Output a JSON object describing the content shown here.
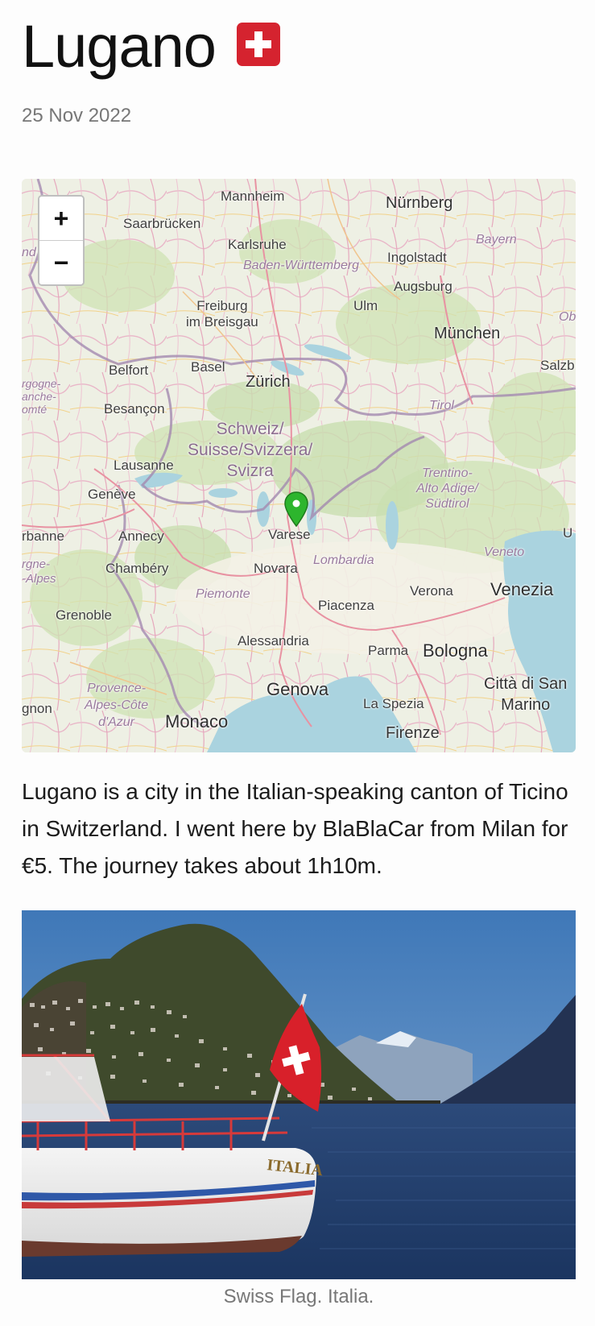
{
  "header": {
    "title": "Lugano",
    "flag": "swiss-flag-icon",
    "date": "25 Nov 2022"
  },
  "map": {
    "zoom_in_label": "+",
    "zoom_out_label": "−",
    "marker": "map-pin-icon",
    "marker_color": "#2db52d",
    "labels": {
      "mannheim": "Mannheim",
      "nurnberg": "Nürnberg",
      "saarbrucken": "Saarbrücken",
      "bayern": "Bayern",
      "grand_est": "nd Est",
      "karlsruhe": "Karlsruhe",
      "ingolstadt": "Ingolstadt",
      "baden": "Baden-Württemberg",
      "augsburg": "Augsburg",
      "freiburg": "Freiburg\nim Breisgau",
      "ulm": "Ulm",
      "munchen": "München",
      "ob": "Ob",
      "belfort": "Belfort",
      "basel": "Basel",
      "salzb": "Salzb",
      "zurich": "Zürich",
      "burgogne": "rgogne-\nanche-\nomté",
      "besancon": "Besançon",
      "tirol": "Tirol",
      "schweiz": "Schweiz/\nSuisse/Svizzera/\nSvizra",
      "lausanne": "Lausanne",
      "trentino": "Trentino-\nAlto Adige/\nSüdtirol",
      "geneve": "Genève",
      "varese": "Varese",
      "urbanne": "rbanne",
      "annecy": "Annecy",
      "u": "U",
      "veneto": "Veneto",
      "lombardia": "Lombardia",
      "rhone_alpes": "rgne-\n-Alpes",
      "chambery": "Chambéry",
      "novara": "Novara",
      "verona": "Verona",
      "venezia": "Venezia",
      "piemonte": "Piemonte",
      "piacenza": "Piacenza",
      "grenoble": "Grenoble",
      "alessandria": "Alessandria",
      "parma": "Parma",
      "bologna": "Bologna",
      "genova": "Genova",
      "citta": "Città di San\nMarino",
      "provence": "Provence-\nAlpes-Côte\nd'Azur",
      "avignon": "gnon",
      "monaco": "Monaco",
      "laspezia": "La Spezia",
      "firenze": "Firenze"
    }
  },
  "body": {
    "description": "Lugano is a city in the Italian-speaking canton of Ticino in Switzerland. I went here by BlaBlaCar from Milan for €5. The journey takes about 1h10m."
  },
  "photo": {
    "flag_text": "ITALIA",
    "caption": "Swiss Flag. Italia."
  }
}
